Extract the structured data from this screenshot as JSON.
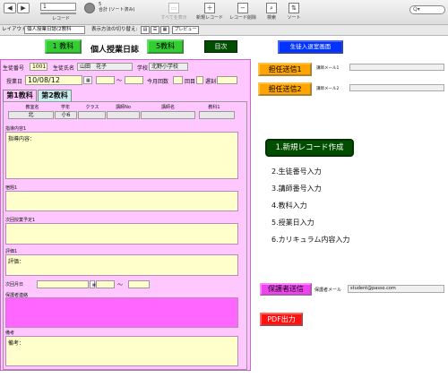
{
  "toolbar": {
    "record_value": "1",
    "record_label": "レコード",
    "count_value": "5",
    "count_label": "合計 (ソート済み)",
    "show_all": "すべてを表示",
    "new_record": "新規レコード",
    "delete_record": "レコード削除",
    "search": "検索",
    "sort": "ソート",
    "search_placeholder": "Q▾"
  },
  "layoutbar": {
    "layout_label": "レイアウト:",
    "layout_value": "個人授業日誌(2教科",
    "view_label": "表示方法の切り替え:",
    "preview_label": "プレビュー"
  },
  "header": {
    "subject1_button": "1 教科",
    "title": "個人授業日誌",
    "subject5_button": "5教科",
    "toc_button": "目次",
    "student_screen_button": "生徒入退室画面"
  },
  "form": {
    "student_no_label": "生徒番号",
    "student_no": "1001",
    "student_name_label": "生徒氏名",
    "student_name": "山田　花子",
    "school_label": "学校",
    "school": "北野小学校",
    "class_date_label": "授業日",
    "class_date": "10/08/12",
    "calendar_icon": "▦",
    "tilde": "〜",
    "month_count_label": "今月回数",
    "times_label": "回目",
    "late_label": "遅刻",
    "tab1": "第1教科",
    "tab2": "第2教科",
    "table_headers": [
      "教室名",
      "学年",
      "クラス",
      "講師No",
      "講師名",
      "教科1"
    ],
    "table_values": [
      "北",
      "小6",
      "",
      "",
      "",
      ""
    ],
    "guidance_label": "指導内容1",
    "guidance_text": "指導内容：",
    "homework_label": "宿題1",
    "next_plan_label": "次回授業予定1",
    "evaluation_label": "評価1",
    "evaluation_text": "評価：",
    "next_month_label": "次回月日",
    "guardian_label": "保護者連絡",
    "notes_label": "備考",
    "notes_text": "備考："
  },
  "right": {
    "teacher_send1": "担任送信1",
    "teacher_send2": "担任送信2",
    "teacher_mail1_label": "講師メール1",
    "teacher_mail2_label": "講師メール2",
    "new_record_step": "1.新規レコード作成",
    "steps": [
      "2.生徒番号入力",
      "3.講師番号入力",
      "4.教科入力",
      "5.授業日入力",
      "6.カリキュラム内容入力"
    ],
    "guardian_send": "保護者送信",
    "guardian_mail_label": "保護者メール",
    "guardian_mail": "student@passo.com",
    "pdf_button": "PDF出力"
  },
  "colors": {
    "panel": "#ffc7ff",
    "field": "#ffffcc",
    "green": "#33cc33",
    "dark_green": "#004d00",
    "orange": "#ffa500",
    "magenta": "#ee44ee",
    "red": "#ff1111",
    "blue": "#0033ff"
  }
}
